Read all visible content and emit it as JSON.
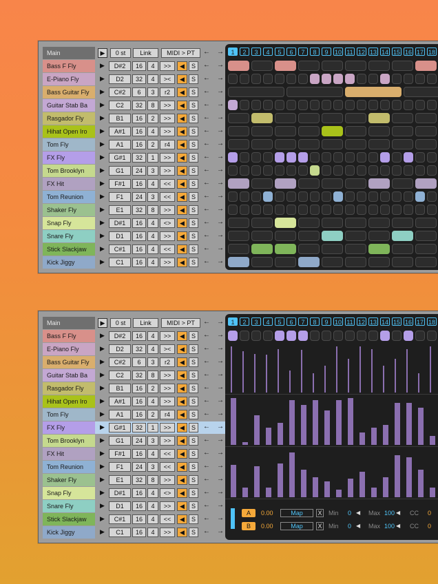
{
  "header": {
    "main_label": "Main",
    "play_glyph": "▶",
    "transpose_label": "0 st",
    "link_label": "Link",
    "midi_label": "MIDI > PT"
  },
  "glyphs": {
    "play": "▶",
    "speaker": "◀",
    "solo": "S",
    "left": "←",
    "right": "→"
  },
  "tracks": [
    {
      "name": "Bass F Fly",
      "color": "#d8908a",
      "note": "D#2",
      "len": "16",
      "div": "4",
      "mode": ">>"
    },
    {
      "name": "E-Piano Fly",
      "color": "#c9a5c4",
      "note": "D2",
      "len": "32",
      "div": "4",
      "mode": "><"
    },
    {
      "name": "Bass Guitar Fly",
      "color": "#d9ae6d",
      "note": "C#2",
      "len": "6",
      "div": "3",
      "mode": "r2"
    },
    {
      "name": "Guitar Stab Ba",
      "color": "#c3a8d4",
      "note": "C2",
      "len": "32",
      "div": "8",
      "mode": ">>"
    },
    {
      "name": "Rasgador Fly",
      "color": "#c2bc6c",
      "note": "B1",
      "len": "16",
      "div": "2",
      "mode": ">>"
    },
    {
      "name": "Hihat Open Iro",
      "color": "#a9c21a",
      "note": "A#1",
      "len": "16",
      "div": "4",
      "mode": ">>"
    },
    {
      "name": "Tom Fly",
      "color": "#9fb7c9",
      "note": "A1",
      "len": "16",
      "div": "2",
      "mode": "r4"
    },
    {
      "name": "FX Fly",
      "color": "#b49ee8",
      "note": "G#1",
      "len": "32",
      "div": "1",
      "mode": ">>"
    },
    {
      "name": "Tom Brooklyn",
      "color": "#c5d98e",
      "note": "G1",
      "len": "24",
      "div": "3",
      "mode": ">>"
    },
    {
      "name": "FX Hit",
      "color": "#b0a1c1",
      "note": "F#1",
      "len": "16",
      "div": "4",
      "mode": "<<"
    },
    {
      "name": "Tom Reunion",
      "color": "#8fb1d4",
      "note": "F1",
      "len": "24",
      "div": "3",
      "mode": "<<"
    },
    {
      "name": "Shaker Fly",
      "color": "#9bc18f",
      "note": "E1",
      "len": "32",
      "div": "8",
      "mode": ">>"
    },
    {
      "name": "Snap Fly",
      "color": "#d6e59a",
      "note": "D#1",
      "len": "16",
      "div": "4",
      "mode": "<>"
    },
    {
      "name": "Snare Fly",
      "color": "#8ecfc3",
      "note": "D1",
      "len": "16",
      "div": "4",
      "mode": ">>"
    },
    {
      "name": "Stick Slackjaw",
      "color": "#7fb55a",
      "note": "C#1",
      "len": "16",
      "div": "4",
      "mode": "<<"
    },
    {
      "name": "Kick Jiggy",
      "color": "#8fa9c9",
      "note": "C1",
      "len": "16",
      "div": "4",
      "mode": ">>"
    }
  ],
  "steps": [
    "1",
    "2",
    "3",
    "4",
    "5",
    "6",
    "7",
    "8",
    "9",
    "10",
    "11",
    "12",
    "13",
    "14",
    "15",
    "16",
    "17",
    "18"
  ],
  "active_step": "1",
  "bottom_selected_track": "FX Fly",
  "bottom_panel": {
    "a_label": "A",
    "a_value": "0.00",
    "b_label": "B",
    "b_value": "0.00",
    "map_label": "Map",
    "x_label": "X",
    "min_label": "Min",
    "min_value": "0",
    "max_label": "Max",
    "max_value": "100",
    "cc_label": "CC",
    "cc_value": "0"
  },
  "lanes": {
    "velocity": [
      0.95,
      0.85,
      0.8,
      0.78,
      0.9,
      0.45,
      0.88,
      0.4,
      0.55,
      0.95,
      0.7,
      0.95,
      0.9,
      0.55,
      0.7,
      0.9,
      0.4,
      0.95,
      0.3
    ],
    "lane2": [
      0.95,
      0.05,
      0.6,
      0.35,
      0.45,
      0.9,
      0.8,
      0.9,
      0.7,
      0.9,
      0.95,
      0.25,
      0.35,
      0.4,
      0.85,
      0.85,
      0.75,
      0.18
    ],
    "lane3": [
      0.65,
      0.2,
      0.62,
      0.2,
      0.68,
      0.9,
      0.55,
      0.4,
      0.32,
      0.15,
      0.38,
      0.52,
      0.2,
      0.4,
      0.85,
      0.8,
      0.55,
      0.2
    ]
  }
}
